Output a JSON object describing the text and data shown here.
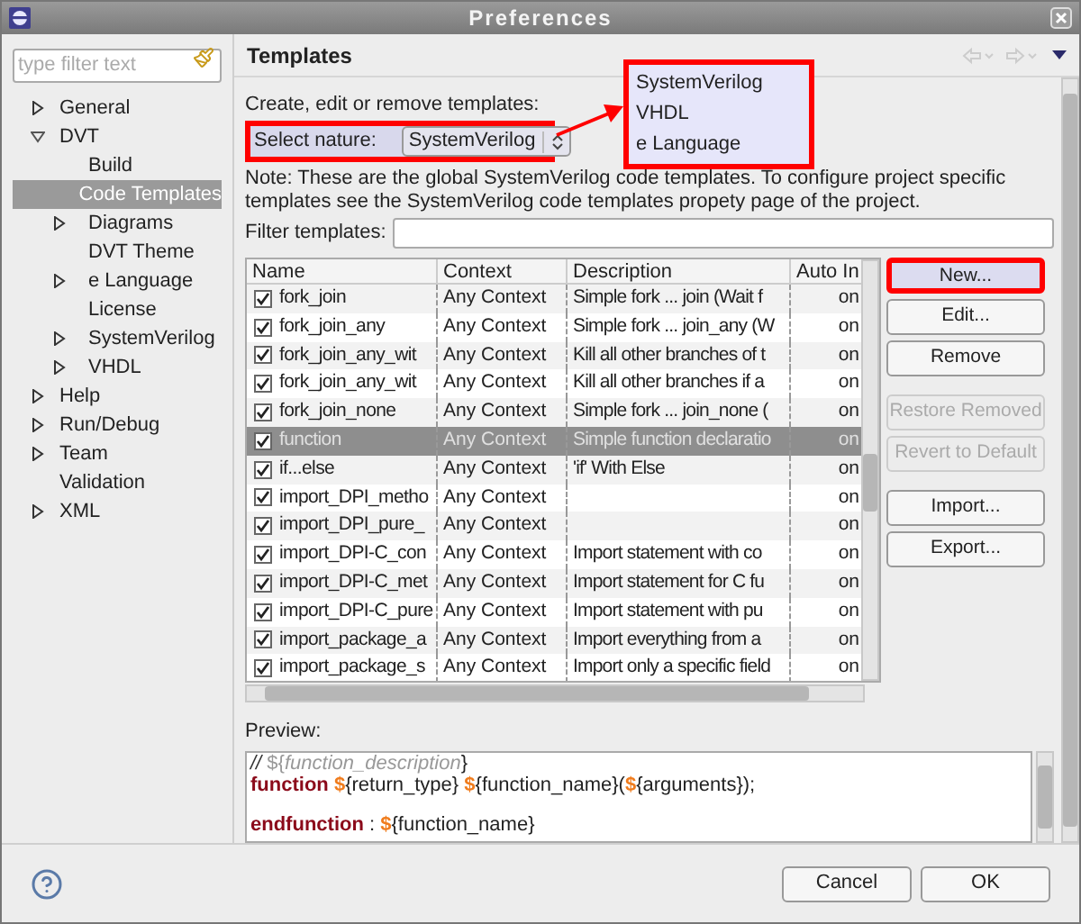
{
  "window": {
    "title": "Preferences"
  },
  "sidebar": {
    "filter_placeholder": "type filter text",
    "tree": [
      {
        "label": "General",
        "expanded": false,
        "selected": false
      },
      {
        "label": "DVT",
        "expanded": true,
        "selected": false,
        "children": [
          {
            "label": "Build",
            "selected": false
          },
          {
            "label": "Code Templates",
            "selected": true
          },
          {
            "label": "Diagrams",
            "expanded": false,
            "selected": false
          },
          {
            "label": "DVT Theme",
            "selected": false
          },
          {
            "label": "e Language",
            "expanded": false,
            "selected": false
          },
          {
            "label": "License",
            "selected": false
          },
          {
            "label": "SystemVerilog",
            "expanded": false,
            "selected": false
          },
          {
            "label": "VHDL",
            "expanded": false,
            "selected": false
          }
        ]
      },
      {
        "label": "Help",
        "expanded": false,
        "selected": false
      },
      {
        "label": "Run/Debug",
        "expanded": false,
        "selected": false
      },
      {
        "label": "Team",
        "expanded": false,
        "selected": false
      },
      {
        "label": "Validation",
        "selected": false
      },
      {
        "label": "XML",
        "expanded": false,
        "selected": false
      }
    ]
  },
  "page": {
    "title": "Templates",
    "intro": "Create, edit or remove templates:",
    "nature_label": "Select nature:",
    "nature_value": "SystemVerilog",
    "nature_popup": [
      "SystemVerilog",
      "VHDL",
      "e Language"
    ],
    "note": "Note:  These are the global SystemVerilog code templates. To configure project specific templates see the SystemVerilog code templates propety page of the project.",
    "filter_label": "Filter templates:"
  },
  "table": {
    "columns": [
      "Name",
      "Context",
      "Description",
      "Auto In"
    ],
    "rows": [
      {
        "checked": true,
        "selected": false,
        "name": "fork_join",
        "context": "Any Context",
        "description": "Simple fork ... join (Wait f",
        "auto": "on"
      },
      {
        "checked": true,
        "selected": false,
        "name": "fork_join_any",
        "context": "Any Context",
        "description": "Simple fork ... join_any (W",
        "auto": "on"
      },
      {
        "checked": true,
        "selected": false,
        "name": "fork_join_any_wit",
        "context": "Any Context",
        "description": "Kill all other branches of t",
        "auto": "on"
      },
      {
        "checked": true,
        "selected": false,
        "name": "fork_join_any_wit",
        "context": "Any Context",
        "description": "Kill all other branches if a",
        "auto": "on"
      },
      {
        "checked": true,
        "selected": false,
        "name": "fork_join_none",
        "context": "Any Context",
        "description": "Simple fork ... join_none (",
        "auto": "on"
      },
      {
        "checked": true,
        "selected": true,
        "name": "function",
        "context": "Any Context",
        "description": "Simple function declaratio",
        "auto": "on"
      },
      {
        "checked": true,
        "selected": false,
        "name": "if...else",
        "context": "Any Context",
        "description": "'if' With Else",
        "auto": "on"
      },
      {
        "checked": true,
        "selected": false,
        "name": "import_DPI_metho",
        "context": "Any Context",
        "auto": "on"
      },
      {
        "checked": true,
        "selected": false,
        "name": "import_DPI_pure_",
        "context": "Any Context",
        "auto": "on"
      },
      {
        "checked": true,
        "selected": false,
        "name": "import_DPI-C_con",
        "context": "Any Context",
        "description": "Import statement with co",
        "auto": "on"
      },
      {
        "checked": true,
        "selected": false,
        "name": "import_DPI-C_met",
        "context": "Any Context",
        "description": "Import statement for C fu",
        "auto": "on"
      },
      {
        "checked": true,
        "selected": false,
        "name": "import_DPI-C_pure",
        "context": "Any Context",
        "description": "Import statement with pu",
        "auto": "on"
      },
      {
        "checked": true,
        "selected": false,
        "name": "import_package_a",
        "context": "Any Context",
        "description": "Import everything from a",
        "auto": "on"
      },
      {
        "checked": true,
        "selected": false,
        "name": "import_package_s",
        "context": "Any Context",
        "description": "Import only a specific field",
        "auto": "on"
      }
    ]
  },
  "buttons": [
    {
      "label": "New...",
      "disabled": false,
      "highlighted": true
    },
    {
      "label": "Edit...",
      "disabled": false,
      "highlighted": false
    },
    {
      "label": "Remove",
      "disabled": false,
      "highlighted": false
    },
    {
      "label": "Restore Removed",
      "disabled": true,
      "highlighted": false
    },
    {
      "label": "Revert to Default",
      "disabled": true,
      "highlighted": false
    },
    {
      "label": "Import...",
      "disabled": false,
      "highlighted": false
    },
    {
      "label": "Export...",
      "disabled": false,
      "highlighted": false
    }
  ],
  "preview": {
    "label": "Preview:",
    "lines": [
      {
        "kind": "code",
        "tokens": [
          {
            "kind": "comment",
            "text": "// "
          },
          {
            "kind": "dollar_muted",
            "text": "$"
          },
          {
            "kind": "muted",
            "text": "{"
          },
          {
            "kind": "italic",
            "text": "function_description"
          },
          {
            "kind": "text",
            "text": "}"
          }
        ]
      },
      {
        "kind": "code",
        "tokens": [
          {
            "kind": "keyword",
            "text": "function"
          },
          {
            "kind": "dollar",
            "text": " $"
          },
          {
            "kind": "text",
            "text": "{return_type} "
          },
          {
            "kind": "dollar",
            "text": "$"
          },
          {
            "kind": "text",
            "text": "{function_name}("
          },
          {
            "kind": "dollar",
            "text": "$"
          },
          {
            "kind": "text",
            "text": "{arguments});"
          }
        ]
      },
      {
        "kind": "blank"
      },
      {
        "kind": "code",
        "tokens": [
          {
            "kind": "keyword",
            "text": "endfunction"
          },
          {
            "kind": "text",
            "text": " : "
          },
          {
            "kind": "dollar",
            "text": "$"
          },
          {
            "kind": "text",
            "text": "{function_name}"
          }
        ]
      }
    ]
  },
  "footer": {
    "buttons": [
      "Cancel",
      "OK"
    ]
  }
}
